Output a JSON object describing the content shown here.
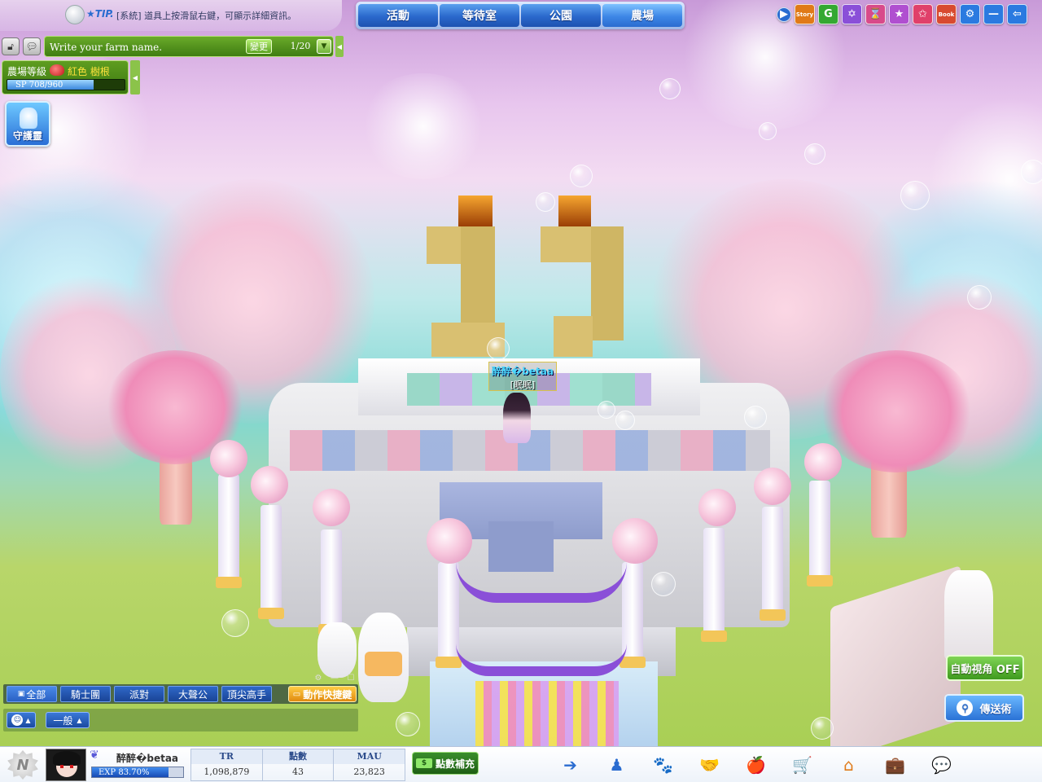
{
  "topbar": {
    "tip_label": "★TIP.",
    "tip_text": "[系統] 道具上按滑鼠右鍵，可顯示詳細資訊。",
    "tabs": [
      {
        "label": "活動",
        "active": false
      },
      {
        "label": "等待室",
        "active": false
      },
      {
        "label": "公園",
        "active": false
      },
      {
        "label": "農場",
        "active": true
      }
    ],
    "icons": [
      {
        "name": "expand-arrow-icon",
        "glyph": "▶",
        "color": "#2a6cd0"
      },
      {
        "name": "story-icon",
        "glyph": "Story",
        "color": "#e07a18"
      },
      {
        "name": "g-icon",
        "glyph": "G",
        "color": "#34a832"
      },
      {
        "name": "star-badge-icon",
        "glyph": "✡",
        "color": "#8a4fd8"
      },
      {
        "name": "hourglass-icon",
        "glyph": "⌛",
        "color": "#d84a8a"
      },
      {
        "name": "new-star-icon",
        "glyph": "★",
        "color": "#b04fd0"
      },
      {
        "name": "favorite-star-icon",
        "glyph": "✩",
        "color": "#e0406a"
      },
      {
        "name": "book-icon",
        "glyph": "Book",
        "color": "#d84a30"
      },
      {
        "name": "settings-gear-icon",
        "glyph": "⚙",
        "color": "#2a7ae0"
      },
      {
        "name": "minimize-icon",
        "glyph": "—",
        "color": "#2a7ae0"
      },
      {
        "name": "back-arrow-icon",
        "glyph": "⇦",
        "color": "#2a7ae0"
      }
    ]
  },
  "farm": {
    "name_placeholder": "Write your farm name.",
    "change_label": "變更",
    "page_count": "1/20",
    "level_label": "農場等級",
    "level_name": "紅色 樹根",
    "sp_text": "SP 708/960",
    "sp_fraction": 0.7375
  },
  "guardian": {
    "label": "守護靈"
  },
  "character": {
    "name": "醉醉�betaa",
    "title": "[眠眠]"
  },
  "chat": {
    "tabs": [
      {
        "label": "全部",
        "active": true
      },
      {
        "label": "騎士團",
        "active": false
      },
      {
        "label": "派對",
        "active": false
      },
      {
        "label": "大聲公",
        "active": false
      },
      {
        "label": "頂尖高手",
        "active": false
      }
    ],
    "hotkey_label": "動作快捷鍵",
    "channel": "一般"
  },
  "right_buttons": {
    "auto_camera": "自動視角 OFF",
    "teleport": "傳送術"
  },
  "player": {
    "name": "醉醉�betaa",
    "exp_text": "EXP 83.70%",
    "exp_fraction": 0.837,
    "stats": [
      {
        "label": "TR",
        "value": "1,098,879"
      },
      {
        "label": "點數",
        "value": "43"
      },
      {
        "label": "MAU",
        "value": "23,823"
      }
    ],
    "recharge_label": "點數補充"
  },
  "dock": [
    {
      "name": "dock-expand-icon",
      "glyph": "➔",
      "color": "#2a6cd0"
    },
    {
      "name": "dock-community-icon",
      "glyph": "♟",
      "color": "#2a6cd0"
    },
    {
      "name": "dock-pet-paw-icon",
      "glyph": "🐾",
      "color": "#2a6cd0"
    },
    {
      "name": "dock-handshake-icon",
      "glyph": "🤝",
      "color": "#2a6cd0"
    },
    {
      "name": "dock-fruit-icon",
      "glyph": "🍎",
      "color": "#e07a18"
    },
    {
      "name": "dock-shop-cart-icon",
      "glyph": "🛒",
      "color": "#e07a18"
    },
    {
      "name": "dock-home-icon",
      "glyph": "⌂",
      "color": "#e07a18"
    },
    {
      "name": "dock-inventory-bag-icon",
      "glyph": "💼",
      "color": "#2a6cd0"
    },
    {
      "name": "dock-chat-icon",
      "glyph": "💬",
      "color": "#2a6cd0"
    }
  ]
}
